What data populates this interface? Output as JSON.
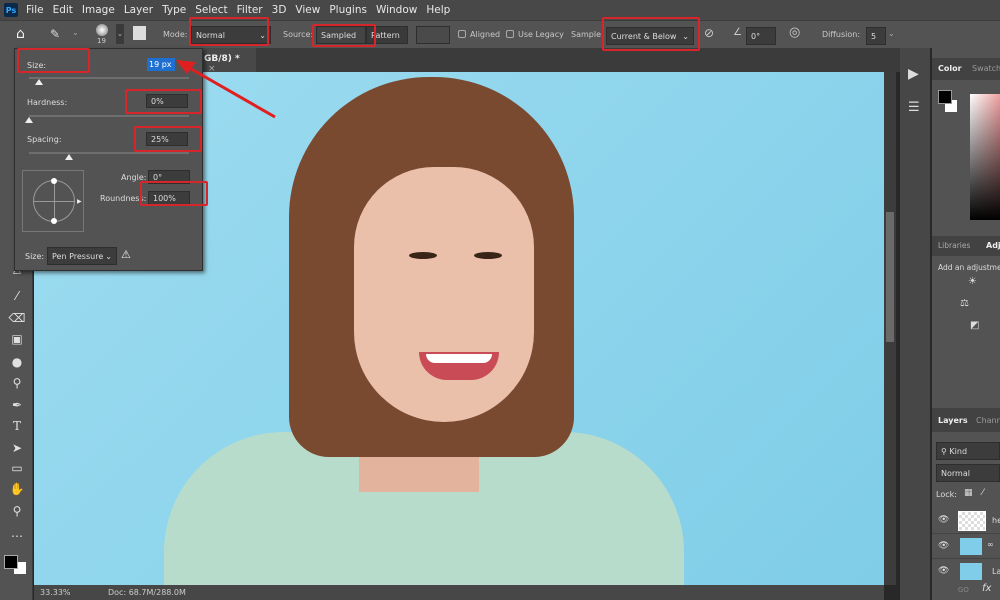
{
  "menu": {
    "logo": "Ps",
    "items": [
      "File",
      "Edit",
      "Image",
      "Layer",
      "Type",
      "Select",
      "Filter",
      "3D",
      "View",
      "Plugins",
      "Window",
      "Help"
    ]
  },
  "options": {
    "brush_size_preview": "19",
    "mode_label": "Mode:",
    "mode_value": "Normal",
    "source_label": "Source:",
    "source_sampled": "Sampled",
    "source_pattern": "Pattern",
    "aligned_label": "Aligned",
    "use_legacy_label": "Use Legacy",
    "sample_label": "Sample:",
    "sample_value": "Current & Below",
    "angle_value": "0°",
    "diffusion_label": "Diffusion:",
    "diffusion_value": "5"
  },
  "document_tab": {
    "title": "GB/8) *",
    "close": "×"
  },
  "brush_popup": {
    "size_label": "Size:",
    "size_value": "19 px",
    "hardness_label": "Hardness:",
    "hardness_value": "0%",
    "spacing_label": "Spacing:",
    "spacing_value": "25%",
    "angle_label": "Angle:",
    "angle_value": "0°",
    "roundness_label": "Roundness:",
    "roundness_value": "100%",
    "size_control_label": "Size:",
    "size_control_value": "Pen Pressure",
    "size_pct": 0.06,
    "hardness_pct": 0,
    "spacing_pct": 0.25
  },
  "status": {
    "zoom": "33.33%",
    "doc": "Doc: 68.7M/288.0M"
  },
  "right_panel": {
    "color_tab": "Color",
    "swatches_tab": "Swatch",
    "libraries_tab": "Libraries",
    "adjustments_tab": "Adj",
    "adjust_hint": "Add an adjustme",
    "layers_tab": "Layers",
    "channels_tab": "Chann",
    "kind_filter": "Kind",
    "blend_mode": "Normal",
    "lock_label": "Lock:",
    "layers": [
      {
        "name": "he"
      },
      {
        "name": ""
      },
      {
        "name": "La"
      }
    ],
    "footer_link": "GO",
    "footer_fx": "fx"
  },
  "colors": {
    "annotation": "#d6262c",
    "canvas_bg": "#8fd4ea",
    "selection": "#1f6fd1"
  }
}
